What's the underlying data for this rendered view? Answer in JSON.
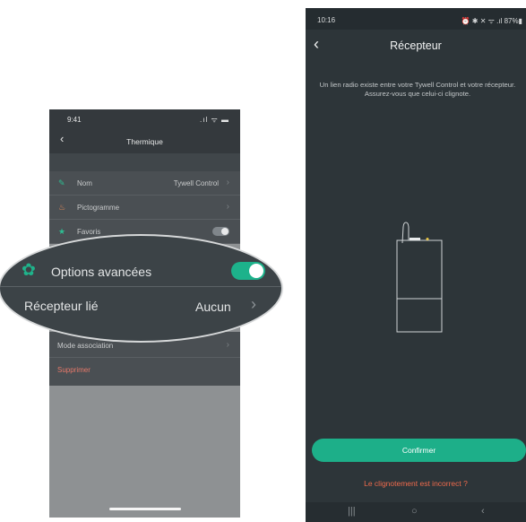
{
  "left_screen": {
    "status_time": "9:41",
    "status_icons": ".ıl ᯤ ▬",
    "back_icon": "chevron-left-icon",
    "title": "Thermique",
    "rows": [
      {
        "icon": "✎",
        "icon_name": "pencil-icon",
        "icon_color": "#2ebd92",
        "label": "Nom",
        "value": "Tywell Control",
        "chevron": "›"
      },
      {
        "icon": "♨",
        "icon_name": "pictogram-icon",
        "icon_color": "#e08a5a",
        "label": "Pictogramme",
        "value": "",
        "chevron": "›"
      },
      {
        "icon": "★",
        "icon_name": "star-icon",
        "icon_color": "#2ebd92",
        "label": "Favoris",
        "value": "",
        "toggle": "off"
      }
    ],
    "mode_association": "Mode association",
    "mode_chevron": "›",
    "delete_label": "Supprimer",
    "delete_color": "#e7796a",
    "magnifier": {
      "gear_icon": "✿",
      "options_label": "Options avancées",
      "options_toggle": "on",
      "receiver_label": "Récepteur lié",
      "receiver_value": "Aucun",
      "receiver_chevron": "›"
    }
  },
  "right_screen": {
    "status_time": "10:16",
    "status_icons": "⏰ ✱ ✕ ᯤ .ıl 87%▮",
    "back_icon": "chevron-left-icon",
    "title": "Récepteur",
    "description": "Un lien radio existe entre votre Tywell Control et votre récepteur. Assurez-vous que celui-ci clignote.",
    "confirm_label": "Confirmer",
    "incorrect_label": "Le clignotement est incorrect ?",
    "accent": "#1daf89",
    "link_color": "#ee6a4c",
    "android_nav": {
      "recent": "|||",
      "home": "○",
      "back": "‹"
    }
  }
}
